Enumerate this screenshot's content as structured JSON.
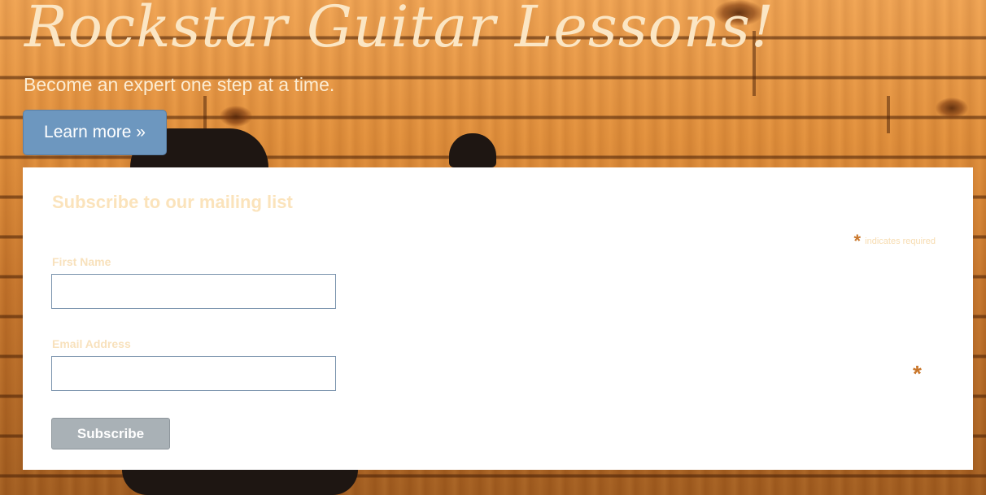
{
  "hero": {
    "title": "Rockstar Guitar Lessons!",
    "tagline": "Become an expert one step at a time.",
    "learn_more_label": "Learn more »"
  },
  "signup": {
    "heading": "Subscribe to our mailing list",
    "required_note": "indicates required",
    "required_marker": "*",
    "fields": [
      {
        "label": "First Name",
        "value": ""
      },
      {
        "label": "Email Address",
        "value": ""
      }
    ],
    "submit_label": "Subscribe"
  },
  "colors": {
    "accent_button": "#6d97bf",
    "required_marker": "#c9762a",
    "title_text": "#fbe6c4"
  }
}
